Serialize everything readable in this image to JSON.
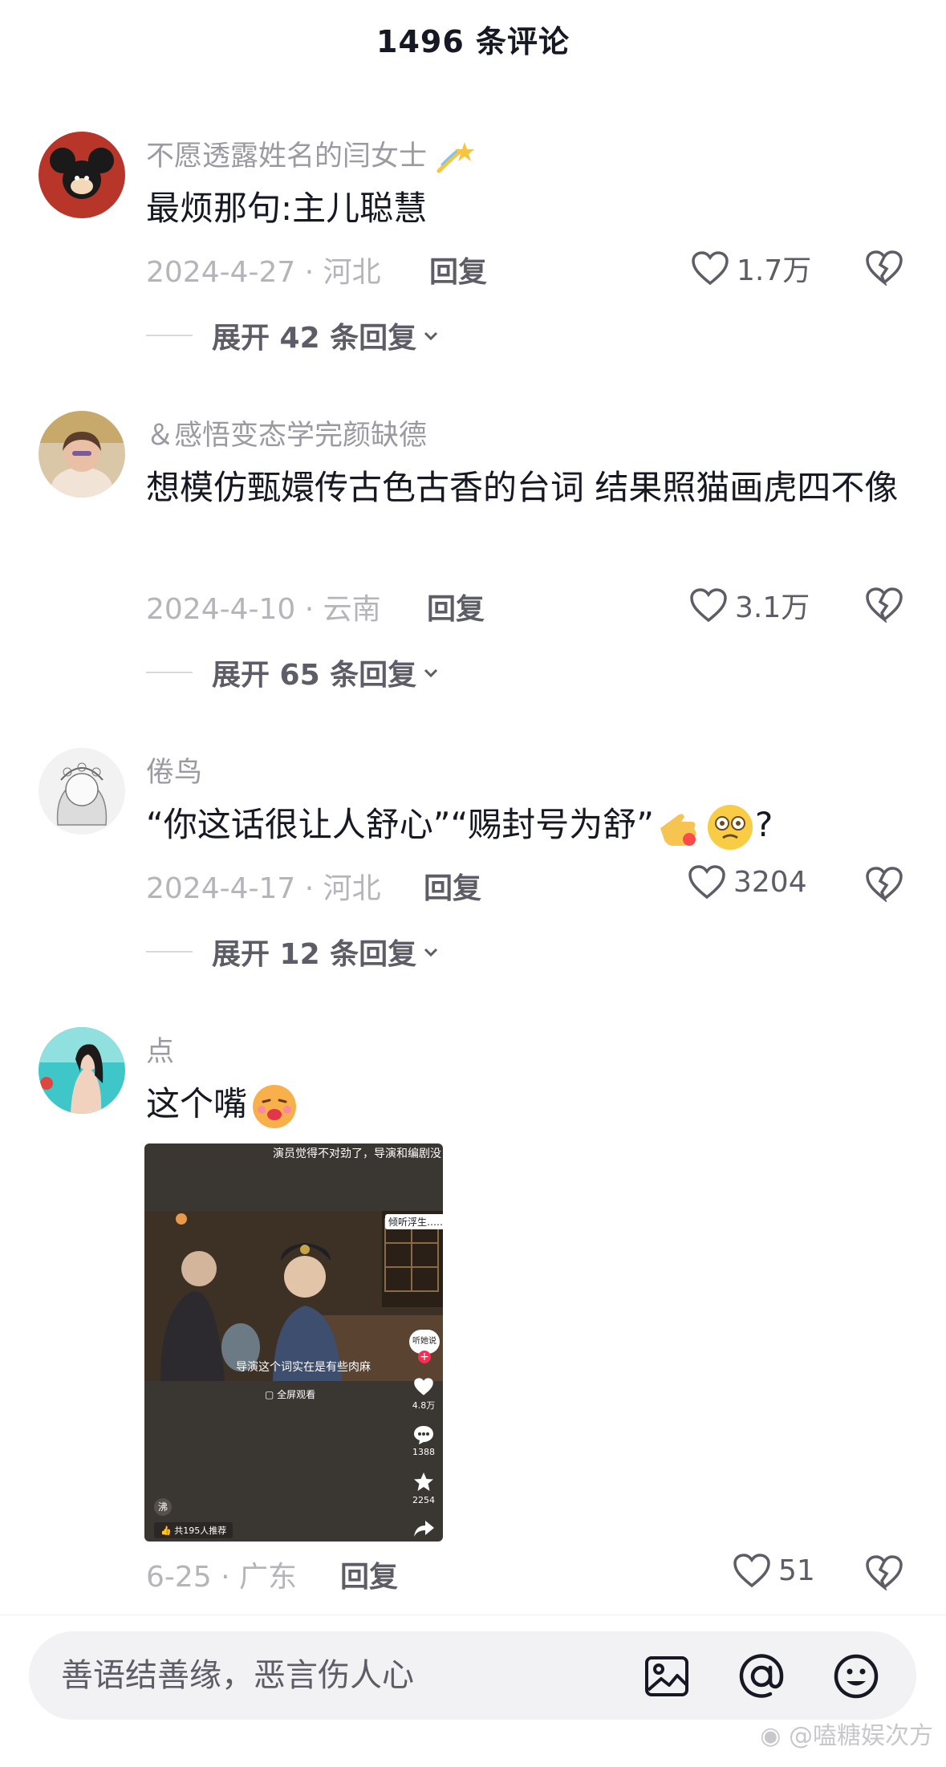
{
  "header": {
    "title": "1496 条评论"
  },
  "comments": [
    {
      "username": "不愿透露姓名的闫女士",
      "text": "最烦那句:主儿聪慧",
      "date_location": "2024-4-27 · 河北",
      "reply_label": "回复",
      "likes": "1.7万",
      "expand_label": "展开 42 条回复"
    },
    {
      "username": "＆感悟变态学完颜缺德",
      "text": "想模仿甄嬛传古色古香的台词  结果照猫画虎四不像",
      "date_location": "2024-4-10 · 云南",
      "reply_label": "回复",
      "likes": "3.1万",
      "expand_label": "展开 65 条回复"
    },
    {
      "username": "倦鸟",
      "text": "“你这话很让人舒心”“赐封号为舒”",
      "text_suffix": "?",
      "date_location": "2024-4-17 · 河北",
      "reply_label": "回复",
      "likes": "3204",
      "expand_label": "展开 12 条回复"
    },
    {
      "username": "点",
      "text": "这个嘴",
      "date_location": "6-25 · 广东",
      "reply_label": "回复",
      "likes": "51"
    }
  ],
  "video": {
    "top_caption": "演员觉得不对劲了，导演和编剧没是",
    "tag": "倾听浮生……",
    "subtitle": "导演这个词实在是有些肉麻",
    "fullscreen_label": "全屏观看",
    "listen_label": "听她说",
    "like_count": "4.8万",
    "comment_count": "1388",
    "star_count": "2254",
    "recommend_label": "共195人推荐",
    "watermark_char": "沸"
  },
  "input": {
    "placeholder": "善语结善缘，恶言伤人心"
  },
  "watermark": "@嗑糖娱次方",
  "icons": [
    "heart-icon",
    "broken-heart-icon",
    "chevron-down-icon",
    "image-icon",
    "at-icon",
    "emoji-icon"
  ],
  "colors": {
    "text": "#161823",
    "muted": "#9a9aa2",
    "light": "#b4b4ba",
    "accent": "#fe2c55"
  }
}
